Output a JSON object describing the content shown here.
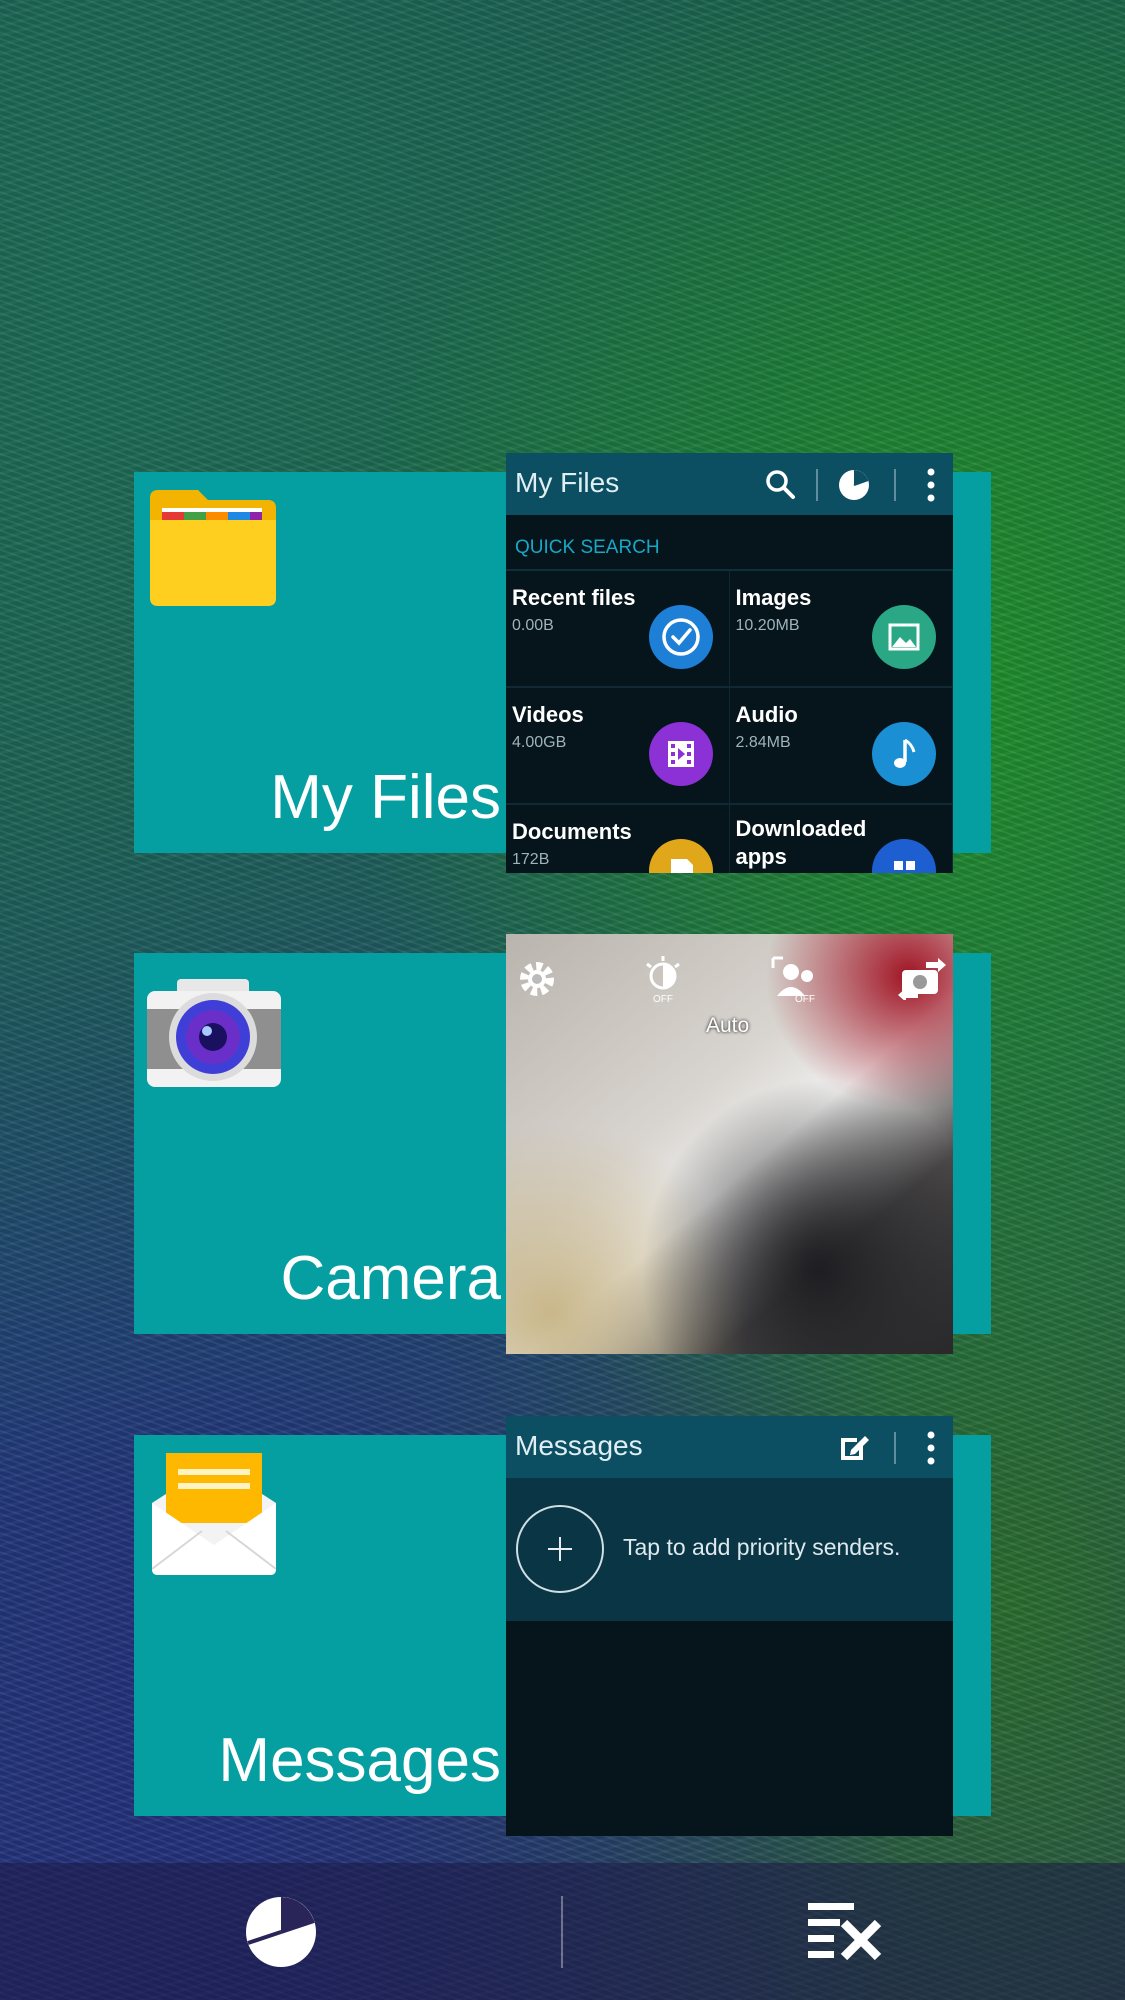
{
  "recents": [
    {
      "app_label": "My Files",
      "thumbnail": {
        "title": "My Files",
        "section": "QUICK SEARCH",
        "items": [
          {
            "name": "Recent files",
            "size": "0.00B",
            "color": "#1e7fd6"
          },
          {
            "name": "Images",
            "size": "10.20MB",
            "color": "#2aa784"
          },
          {
            "name": "Videos",
            "size": "4.00GB",
            "color": "#8b31d6"
          },
          {
            "name": "Audio",
            "size": "2.84MB",
            "color": "#1b8fd4"
          },
          {
            "name": "Documents",
            "size": "172B",
            "color": "#e1a71a"
          },
          {
            "name": "Downloaded apps",
            "size": "",
            "color": "#1d5fd0"
          }
        ]
      }
    },
    {
      "app_label": "Camera",
      "thumbnail": {
        "mode": "Auto"
      }
    },
    {
      "app_label": "Messages",
      "thumbnail": {
        "title": "Messages",
        "priority_text": "Tap to add priority senders."
      }
    }
  ],
  "colors": {
    "card": "#069fa1",
    "thumb_bar": "#0c4f63"
  },
  "icons": {
    "my_files": [
      "search-icon",
      "storage-usage-icon",
      "more-options-icon"
    ],
    "camera": [
      "settings-gear-icon",
      "hdr-off-icon",
      "face-detect-off-icon",
      "switch-camera-icon"
    ],
    "messages": [
      "compose-icon",
      "more-options-icon",
      "add-circle-icon"
    ],
    "navbar": [
      "task-manager-icon",
      "close-all-icon"
    ]
  }
}
